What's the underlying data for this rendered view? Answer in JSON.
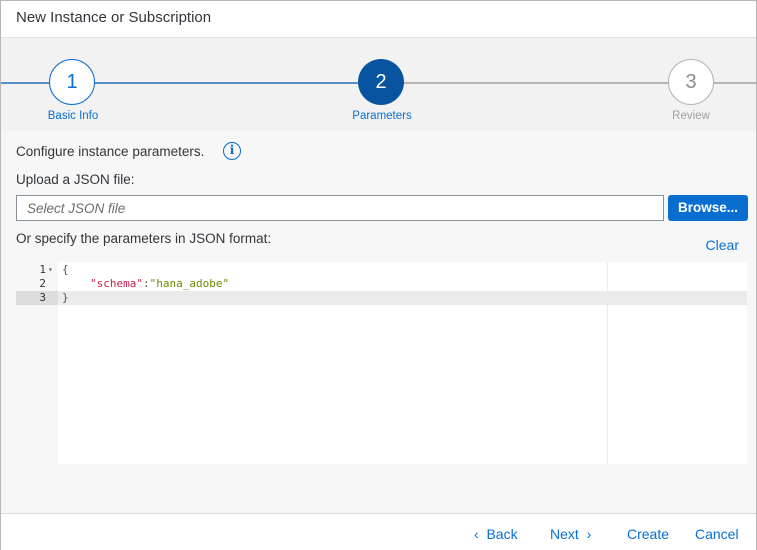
{
  "dialog": {
    "title": "New Instance or Subscription"
  },
  "wizard": {
    "steps": [
      {
        "number": "1",
        "label": "Basic Info",
        "state": "completed"
      },
      {
        "number": "2",
        "label": "Parameters",
        "state": "current"
      },
      {
        "number": "3",
        "label": "Review",
        "state": "upcoming"
      }
    ]
  },
  "content": {
    "intro": "Configure instance parameters.",
    "upload_label": "Upload a JSON file:",
    "file_placeholder": "Select JSON file",
    "browse_label": "Browse...",
    "json_label": "Or specify the parameters in JSON format:",
    "clear_label": "Clear"
  },
  "editor": {
    "lines": [
      {
        "n": "1",
        "text": "{"
      },
      {
        "n": "2",
        "key": "\"schema\"",
        "sep": ":",
        "value": "\"hana_adobe\""
      },
      {
        "n": "3",
        "text": "}"
      }
    ]
  },
  "footer": {
    "back": "Back",
    "next": "Next",
    "create": "Create",
    "cancel": "Cancel"
  },
  "colors": {
    "accent": "#0a6ed1",
    "current_step": "#0854a0",
    "json_key": "#c7254e",
    "json_string": "#6a8a00"
  }
}
